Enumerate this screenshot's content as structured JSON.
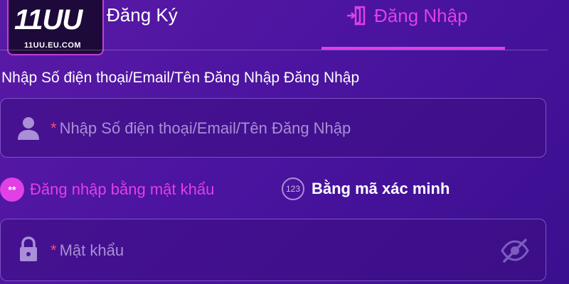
{
  "logo": {
    "text": "11UU",
    "domain": "11UU.EU.COM"
  },
  "tabs": {
    "register_label": "Đăng Ký",
    "login_label": "Đăng Nhập",
    "active": "login"
  },
  "login_form": {
    "field_title": "Nhập Số điện thoại/Email/Tên Đăng Nhập Đăng Nhập",
    "username": {
      "required_mark": "*",
      "placeholder": "Nhập Số điện thoại/Email/Tên Đăng Nhập",
      "value": "",
      "icon": "user-icon"
    },
    "methods": {
      "password_label": "Đăng nhập bằng mật khẩu",
      "password_icon_text": "**",
      "code_label": "Bằng mã xác minh",
      "code_icon_text": "123",
      "selected": "password"
    },
    "password": {
      "required_mark": "*",
      "placeholder": "Mật khẩu",
      "value": "",
      "icon": "lock-icon",
      "toggle_icon": "eye-off-icon"
    }
  },
  "colors": {
    "background": "#4b14a0",
    "accent": "#e040e6",
    "required": "#ff4b6e",
    "placeholder": "#a88fd6"
  }
}
